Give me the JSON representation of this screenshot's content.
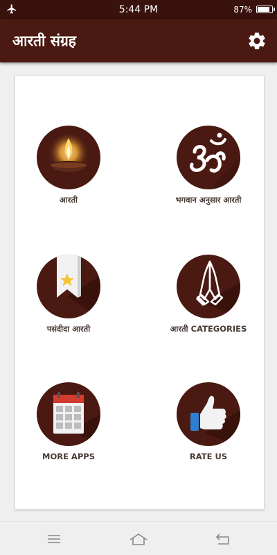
{
  "status": {
    "time": "5:44 PM",
    "battery": "87%",
    "battery_level": 0.87
  },
  "app": {
    "title": "आरती संग्रह",
    "settings_icon": "gear-icon"
  },
  "tiles": [
    {
      "label": "आरती",
      "icon": "diya-lamp-icon"
    },
    {
      "label": "भगवान अनुसार आरती",
      "icon": "om-icon"
    },
    {
      "label": "पसंदीदा आरती",
      "icon": "bookmark-star-icon"
    },
    {
      "label": "आरती CATEGORIES",
      "icon": "praying-hands-icon"
    },
    {
      "label": "MORE APPS",
      "icon": "calendar-grid-icon"
    },
    {
      "label": "RATE US",
      "icon": "thumbs-up-icon"
    }
  ],
  "colors": {
    "primary": "#4a1a12",
    "status_bar": "#3a120d",
    "label_text": "#4a3a35"
  }
}
